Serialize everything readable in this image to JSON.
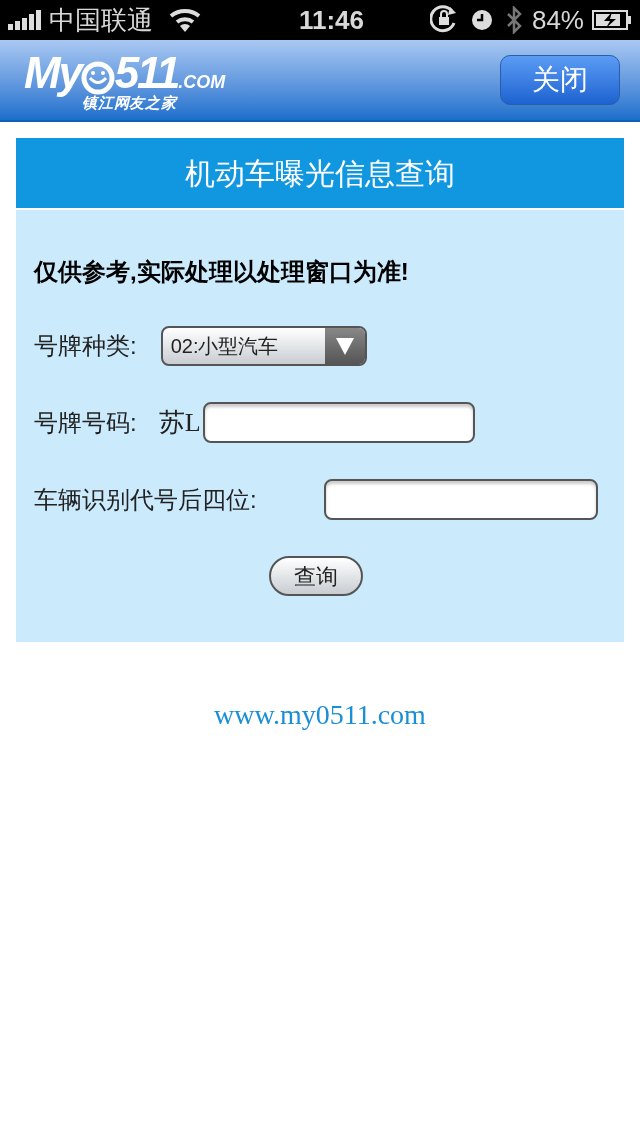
{
  "status_bar": {
    "carrier": "中国联通",
    "time": "11:46",
    "battery": "84%"
  },
  "header": {
    "logo": {
      "name": "My",
      "number": "511",
      "domain": ".COM",
      "tagline": "镇江网友之家"
    },
    "close_button": "关闭"
  },
  "panel": {
    "title": "机动车曝光信息查询",
    "notice": "仅供参考,实际处理以处理窗口为准!",
    "fields": [
      {
        "kind": "select",
        "label": "号牌种类:",
        "value": "02:小型汽车"
      },
      {
        "kind": "input",
        "label": "号牌号码:",
        "prefix": "苏L"
      },
      {
        "kind": "input",
        "label": "车辆识别代号后四位:"
      }
    ],
    "submit": "查询"
  },
  "footer": {
    "link": "www.my0511.com"
  }
}
